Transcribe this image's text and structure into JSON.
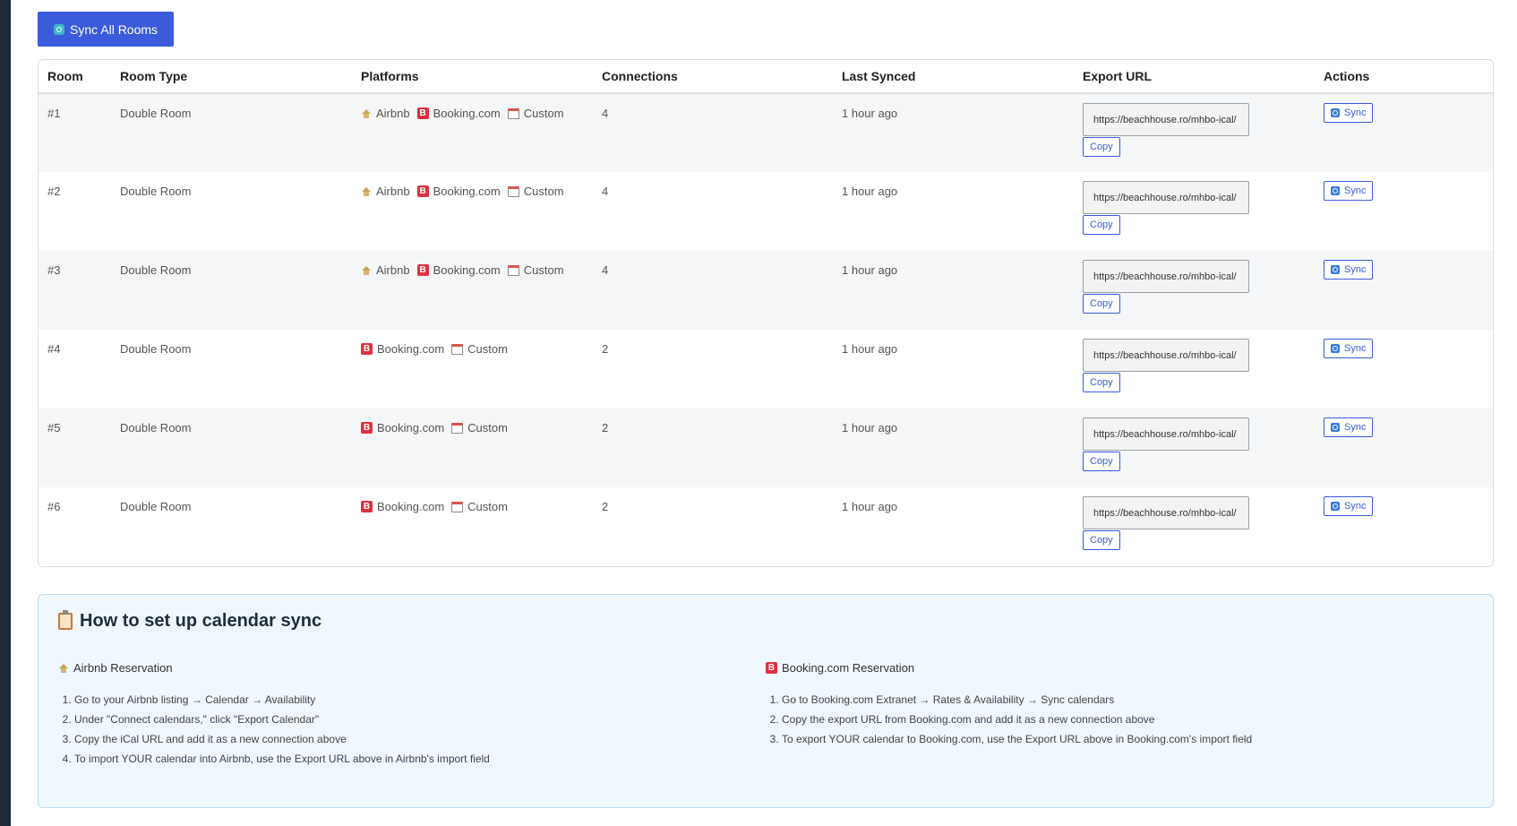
{
  "toolbar": {
    "sync_all_label": "Sync All Rooms"
  },
  "table": {
    "headers": [
      "Room",
      "Room Type",
      "Platforms",
      "Connections",
      "Last Synced",
      "Export URL",
      "Actions"
    ],
    "copy_label": "Copy",
    "sync_label": "Sync",
    "rows": [
      {
        "room": "#1",
        "type": "Double Room",
        "p1": "Airbnb",
        "p2": "Booking.com",
        "p3": "Custom",
        "connections": "4",
        "last_synced": "1 hour ago",
        "export_url": "https://beachhouse.ro/mhbo-ical/"
      },
      {
        "room": "#2",
        "type": "Double Room",
        "p1": "Airbnb",
        "p2": "Booking.com",
        "p3": "Custom",
        "connections": "4",
        "last_synced": "1 hour ago",
        "export_url": "https://beachhouse.ro/mhbo-ical/"
      },
      {
        "room": "#3",
        "type": "Double Room",
        "p1": "Airbnb",
        "p2": "Booking.com",
        "p3": "Custom",
        "connections": "4",
        "last_synced": "1 hour ago",
        "export_url": "https://beachhouse.ro/mhbo-ical/"
      },
      {
        "room": "#4",
        "type": "Double Room",
        "p1": "Booking.com",
        "p2": "Custom",
        "connections": "2",
        "last_synced": "1 hour ago",
        "export_url": "https://beachhouse.ro/mhbo-ical/"
      },
      {
        "room": "#5",
        "type": "Double Room",
        "p1": "Booking.com",
        "p2": "Custom",
        "connections": "2",
        "last_synced": "1 hour ago",
        "export_url": "https://beachhouse.ro/mhbo-ical/"
      },
      {
        "room": "#6",
        "type": "Double Room",
        "p1": "Booking.com",
        "p2": "Custom",
        "connections": "2",
        "last_synced": "1 hour ago",
        "export_url": "https://beachhouse.ro/mhbo-ical/"
      }
    ]
  },
  "help": {
    "title": "How to set up calendar sync",
    "airbnb": {
      "heading": "Airbnb Reservation",
      "steps": [
        "Go to your Airbnb listing → Calendar → Availability",
        "Under \"Connect calendars,\" click \"Export Calendar\"",
        "Copy the iCal URL and add it as a new connection above",
        "To import YOUR calendar into Airbnb, use the Export URL above in Airbnb's import field"
      ]
    },
    "booking": {
      "heading": "Booking.com Reservation",
      "steps": [
        "Go to Booking.com Extranet → Rates & Availability → Sync calendars",
        "Copy the export URL from Booking.com and add it as a new connection above",
        "To export YOUR calendar to Booking.com, use the Export URL above in Booking.com's import field"
      ]
    }
  },
  "colors": {
    "accent": "#3b5bdb",
    "booking_red": "#e0303e",
    "panel_bg": "#f0f7fe"
  }
}
